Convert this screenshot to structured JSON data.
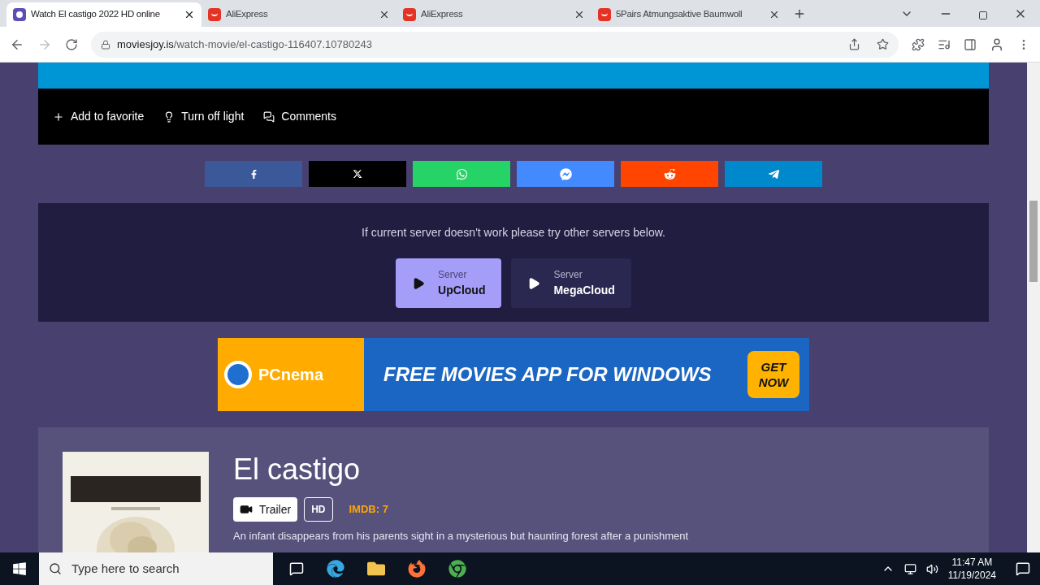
{
  "browser": {
    "tabs": [
      {
        "title": "Watch El castigo 2022 HD online",
        "selected": true,
        "kind": "movie"
      },
      {
        "title": "AliExpress",
        "selected": false,
        "kind": "shop"
      },
      {
        "title": "AliExpress",
        "selected": false,
        "kind": "shop"
      },
      {
        "title": "5Pairs Atmungsaktive Baumwoll",
        "selected": false,
        "kind": "shop"
      }
    ],
    "url_host": "moviesjoy.is",
    "url_path": "/watch-movie/el-castigo-116407.10780243"
  },
  "player_actions": [
    "Add to favorite",
    "Turn off light",
    "Comments"
  ],
  "share_buttons": [
    {
      "kind": "facebook",
      "color": "#3b5998"
    },
    {
      "kind": "x",
      "color": "#000000"
    },
    {
      "kind": "whatsapp",
      "color": "#25d366"
    },
    {
      "kind": "messenger",
      "color": "#448aff"
    },
    {
      "kind": "reddit",
      "color": "#ff4500"
    },
    {
      "kind": "telegram",
      "color": "#0088cc"
    }
  ],
  "servers": {
    "notice": "If current server doesn't work please try other servers below.",
    "items": [
      {
        "label": "Server",
        "name": "UpCloud",
        "selected": true
      },
      {
        "label": "Server",
        "name": "MegaCloud",
        "selected": false
      }
    ]
  },
  "ad": {
    "brand": "PCnema",
    "headline": "FREE MOVIES APP FOR WINDOWS",
    "cta": "GET NOW"
  },
  "movie": {
    "title": "El castigo",
    "trailer": "Trailer",
    "quality": "HD",
    "imdb": "IMDB: 7",
    "description": "An infant disappears from his parents sight in a mysterious but haunting forest after a punishment"
  },
  "taskbar": {
    "search_placeholder": "Type here to search",
    "time": "11:47 AM",
    "date": "11/19/2024"
  }
}
